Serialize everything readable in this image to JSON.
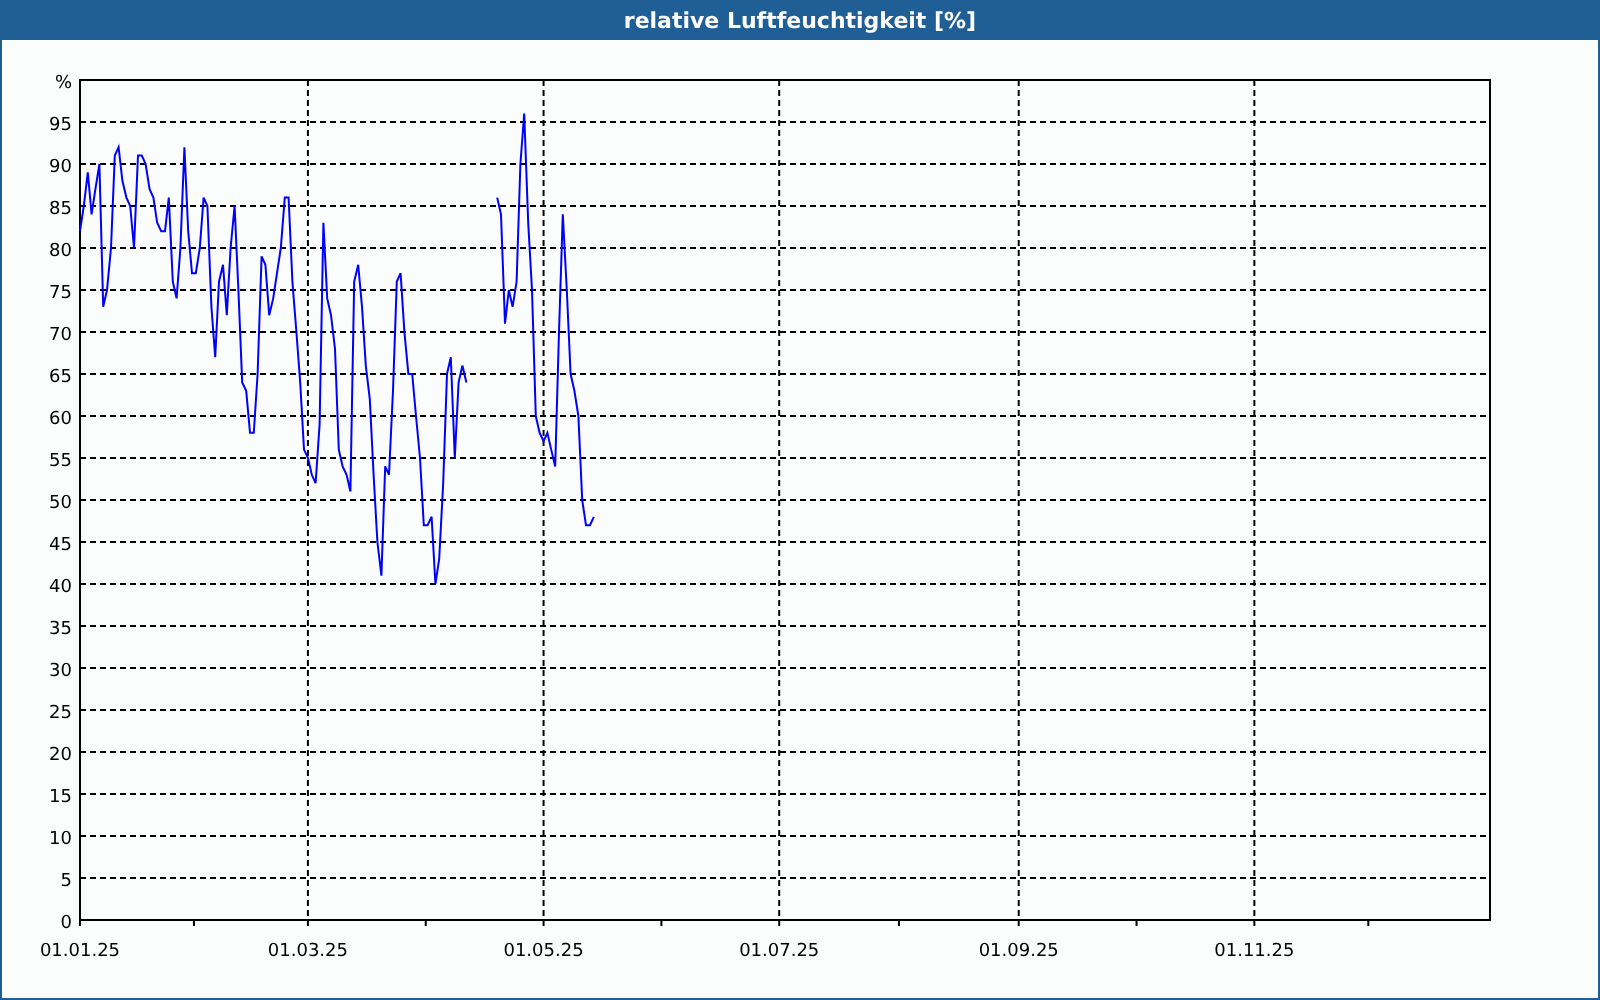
{
  "chart_data": {
    "type": "line",
    "title": "relative Luftfeuchtigkeit [%]",
    "grid": true,
    "ylim": [
      0,
      100
    ],
    "yticks": [
      0,
      5,
      10,
      15,
      20,
      25,
      30,
      35,
      40,
      45,
      50,
      55,
      60,
      65,
      70,
      75,
      80,
      85,
      90,
      95,
      {
        "value": 100,
        "label": "%"
      }
    ],
    "categories": [
      "01.01.25",
      null,
      null,
      null,
      null,
      null,
      null,
      null,
      null,
      null,
      null,
      null,
      null,
      null,
      null,
      null,
      null,
      null,
      null,
      null,
      null,
      null,
      null,
      null,
      null,
      null,
      null,
      null,
      null,
      null,
      null,
      null,
      null,
      null,
      null,
      null,
      null,
      null,
      null,
      null,
      null,
      null,
      null,
      null,
      null,
      null,
      null,
      null,
      null,
      null,
      null,
      null,
      null,
      null,
      null,
      null,
      null,
      null,
      null,
      "01.03.25",
      null,
      null,
      null,
      null,
      null,
      null,
      null,
      null,
      null,
      null,
      null,
      null,
      null,
      null,
      null,
      null,
      null,
      null,
      null,
      null,
      null,
      null,
      null,
      null,
      null,
      null,
      null,
      null,
      null,
      null,
      null,
      null,
      null,
      null,
      null,
      null,
      null,
      null,
      null,
      null,
      null,
      null,
      null,
      null,
      null,
      null,
      null,
      null,
      null,
      null,
      null,
      null,
      null,
      null,
      null,
      null,
      null,
      null,
      null,
      null,
      "01.05.25",
      null,
      null,
      null,
      null,
      null,
      null,
      null,
      null,
      null,
      null,
      null,
      null,
      null,
      null,
      null,
      null,
      null,
      null,
      null,
      null,
      null,
      null,
      null,
      null,
      null,
      null,
      null,
      null,
      null,
      null,
      null,
      null,
      null,
      null,
      null,
      null,
      null,
      null,
      null,
      null,
      null,
      null,
      null,
      null,
      null,
      null,
      null,
      null,
      null,
      null,
      null,
      null,
      null,
      null,
      null,
      null,
      null,
      null,
      null,
      null,
      "01.07.25",
      null,
      null,
      null,
      null,
      null,
      null,
      null,
      null,
      null,
      null,
      null,
      null,
      null,
      null,
      null,
      null,
      null,
      null,
      null,
      null,
      null,
      null,
      null,
      null,
      null,
      null,
      null,
      null,
      null,
      null,
      null,
      null,
      null,
      null,
      null,
      null,
      null,
      null,
      null,
      null,
      null,
      null,
      null,
      null,
      null,
      null,
      null,
      null,
      null,
      null,
      null,
      null,
      null,
      null,
      null,
      null,
      null,
      null,
      null,
      null,
      null,
      "01.09.25",
      null,
      null,
      null,
      null,
      null,
      null,
      null,
      null,
      null,
      null,
      null,
      null,
      null,
      null,
      null,
      null,
      null,
      null,
      null,
      null,
      null,
      null,
      null,
      null,
      null,
      null,
      null,
      null,
      null,
      null,
      null,
      null,
      null,
      null,
      null,
      null,
      null,
      null,
      null,
      null,
      null,
      null,
      null,
      null,
      null,
      null,
      null,
      null,
      null,
      null,
      null,
      null,
      null,
      null,
      null,
      null,
      null,
      null,
      null,
      null,
      "01.11.25",
      null,
      null,
      null,
      null,
      null,
      null,
      null,
      null,
      null,
      null,
      null,
      null,
      null,
      null,
      null,
      null,
      null,
      null,
      null,
      null,
      null,
      null,
      null,
      null,
      null,
      null,
      null,
      null,
      null,
      null,
      null,
      null,
      null,
      null,
      null,
      null,
      null,
      null,
      null,
      null,
      null,
      null,
      null,
      null,
      null,
      null,
      null,
      null,
      null,
      null,
      null,
      null,
      null,
      null,
      null,
      null,
      null,
      null,
      null,
      null,
      null
    ],
    "series": [
      {
        "color": "#0000ff",
        "values": [
          82,
          85,
          89,
          84,
          87,
          90,
          73,
          75,
          80,
          91,
          92,
          88,
          86,
          85,
          80,
          91,
          91,
          90,
          87,
          86,
          83,
          82,
          82,
          86,
          76,
          74,
          80,
          92,
          82,
          77,
          77,
          80,
          86,
          85,
          73,
          67,
          76,
          78,
          72,
          80,
          85,
          75,
          64,
          63,
          58,
          58,
          65,
          79,
          78,
          72,
          74,
          77,
          80,
          86,
          86,
          76,
          70,
          64,
          56,
          55,
          53,
          52,
          59,
          83,
          74,
          72,
          68,
          56,
          54,
          53,
          51,
          76,
          78,
          73,
          66,
          62,
          53,
          45,
          41,
          54,
          53,
          63,
          76,
          77,
          70,
          65,
          65,
          60,
          55,
          47,
          47,
          48,
          40,
          43,
          52,
          65,
          67,
          55,
          64,
          66,
          64,
          null,
          null,
          null,
          null,
          null,
          null,
          null,
          86,
          84,
          71,
          75,
          73,
          76,
          90,
          96,
          83,
          75,
          60,
          58,
          57,
          58,
          56,
          54,
          70,
          84,
          75,
          65,
          63,
          60,
          50,
          47,
          47,
          48,
          null,
          null,
          null,
          null,
          null,
          null,
          null,
          null,
          null,
          null,
          null,
          null,
          null,
          null,
          null,
          null,
          null,
          null,
          null,
          null,
          null,
          null,
          null,
          null,
          null,
          null,
          null,
          null,
          null,
          null,
          null,
          null,
          null,
          null,
          null,
          null,
          null,
          null,
          null,
          null,
          null,
          null,
          null,
          null,
          null,
          null,
          null,
          null,
          null,
          null,
          null,
          null,
          null,
          null,
          null,
          null,
          null,
          null,
          null,
          null,
          null,
          null,
          null,
          null,
          null,
          null,
          null,
          null,
          null,
          null,
          null,
          null,
          null,
          null,
          null,
          null,
          null,
          null,
          null,
          null,
          null,
          null,
          null,
          null,
          null,
          null,
          null,
          null,
          null,
          null,
          null,
          null,
          null,
          null,
          null,
          null,
          null,
          null,
          null,
          null,
          null,
          null,
          null,
          null,
          null,
          null,
          null,
          null,
          null,
          null,
          null,
          null,
          null,
          null,
          null,
          null,
          null,
          null,
          null,
          null,
          null,
          null,
          null,
          null,
          null,
          null,
          null,
          null,
          null,
          null,
          null,
          null,
          null,
          null,
          null,
          null,
          null,
          null,
          null,
          null,
          null,
          null,
          null,
          null,
          null,
          null,
          null,
          null,
          null,
          null,
          null,
          null,
          null,
          null,
          null,
          null,
          null,
          null,
          null,
          null,
          null,
          null,
          null,
          null,
          null,
          null,
          null,
          null,
          null,
          null,
          null,
          null,
          null,
          null,
          null,
          null,
          null,
          null,
          null,
          null,
          null,
          null,
          null,
          null,
          null,
          null,
          null,
          null,
          null,
          null,
          null,
          null,
          null,
          null,
          null,
          null,
          null,
          null,
          null,
          null,
          null,
          null,
          null,
          null,
          null,
          null,
          null,
          null,
          null,
          null,
          null,
          null,
          null,
          null,
          null,
          null,
          null,
          null,
          null,
          null,
          null,
          null,
          null,
          null,
          null,
          null,
          null,
          null,
          null,
          null,
          null,
          null
        ]
      }
    ]
  }
}
